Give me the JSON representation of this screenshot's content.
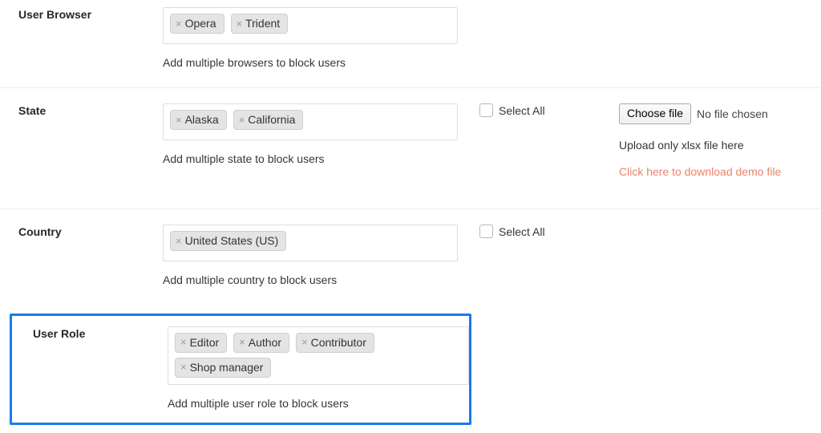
{
  "rows": [
    {
      "key": "user_browser",
      "label": "User Browser",
      "tags": [
        "Opera",
        "Trident"
      ],
      "description": "Add multiple browsers to block users",
      "remove_icon": "×"
    },
    {
      "key": "state",
      "label": "State",
      "tags": [
        "Alaska",
        "California"
      ],
      "description": "Add multiple state to block users",
      "select_all_label": "Select All",
      "remove_icon": "×",
      "upload": {
        "button_label": "Choose file",
        "file_status": "No file chosen",
        "note": "Upload only xlsx file here",
        "demo_link": "Click here to download demo file"
      }
    },
    {
      "key": "country",
      "label": "Country",
      "tags": [
        "United States (US)"
      ],
      "description": "Add multiple country to block users",
      "select_all_label": "Select All",
      "remove_icon": "×"
    },
    {
      "key": "user_role",
      "label": "User Role",
      "tags": [
        "Editor",
        "Author",
        "Contributor",
        "Shop manager"
      ],
      "description": "Add multiple user role to block users",
      "remove_icon": "×",
      "highlighted": true
    }
  ],
  "colors": {
    "highlight_border": "#1a7ae8",
    "demo_link": "#e8836b",
    "tag_background": "#e4e4e4",
    "label_text": "#23282d",
    "row_divider": "#eeeeee"
  }
}
